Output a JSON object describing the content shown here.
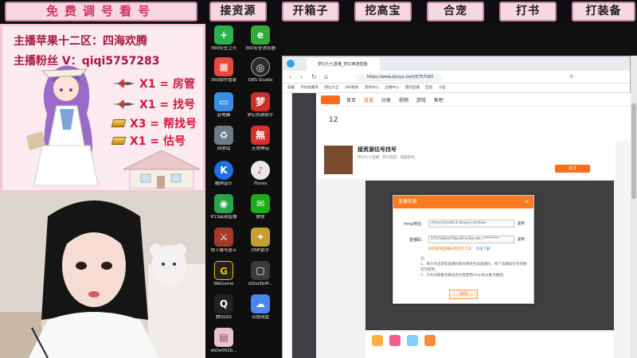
{
  "banner": {
    "main": "免费调号看号",
    "buttons": [
      "接资源",
      "开箱子",
      "挖高宝",
      "合宠",
      "打书",
      "打装备"
    ]
  },
  "info": {
    "line1": "主播苹果十二区：四海欢腾",
    "line2": "主播粉丝 V：qiqi5757283",
    "prizes": [
      {
        "icon": "plane-icon",
        "text": "X1 = 房管"
      },
      {
        "icon": "plane-icon",
        "text": "X1 = 找号"
      },
      {
        "icon": "gold-bar-icon",
        "text": "X3 = 帮找号"
      },
      {
        "icon": "gold-bar-icon",
        "text": "X1 = 估号"
      }
    ]
  },
  "desktop": {
    "icons": [
      {
        "name": "360-security-icon",
        "label": "360安全卫士",
        "color": "#2bb24c",
        "glyph": "+"
      },
      {
        "name": "360-cleaner-icon",
        "label": "360安全浏览器",
        "color": "#36a83a",
        "glyph": "e"
      },
      {
        "name": "360-software-icon",
        "label": "360软件管家",
        "color": "#e84a3a",
        "glyph": "▦"
      },
      {
        "name": "obs-studio-icon",
        "label": "OBS Studio",
        "color": "#2b2b2b",
        "glyph": "◎"
      },
      {
        "name": "computer-icon",
        "label": "此电脑",
        "color": "#3a8ee6",
        "glyph": "▭"
      },
      {
        "name": "game-assistant-icon",
        "label": "梦幻西游助手",
        "color": "#c9302c",
        "glyph": "梦"
      },
      {
        "name": "recycle-bin-icon",
        "label": "回收站",
        "color": "#6b7d8c",
        "glyph": "♻"
      },
      {
        "name": "wuxiancao-icon",
        "label": "无限神话",
        "color": "#d92f2f",
        "glyph": "無"
      },
      {
        "name": "kugou-icon",
        "label": "酷狗音乐",
        "color": "#1e6fe0",
        "glyph": "K"
      },
      {
        "name": "itunes-icon",
        "label": "iTunes",
        "color": "#e8e8e8",
        "glyph": "♪"
      },
      {
        "name": "k13-icon",
        "label": "K13高清直播",
        "color": "#2aa54a",
        "glyph": "◉"
      },
      {
        "name": "wechat-icon",
        "label": "微信",
        "color": "#1aad19",
        "glyph": "✉"
      },
      {
        "name": "mhxy-icon",
        "label": "地下城与勇士",
        "color": "#a33a2a",
        "glyph": "⚔"
      },
      {
        "name": "dnf-icon",
        "label": "DNF助手",
        "color": "#c4a032",
        "glyph": "✦"
      },
      {
        "name": "welgame-icon",
        "label": "WeGame",
        "color": "#222",
        "glyph": "G"
      },
      {
        "name": "file-icon",
        "label": "d2ba3b4f...",
        "color": "#3b3b3b",
        "glyph": "▢"
      },
      {
        "name": "qq-icon",
        "label": "腾讯QQ",
        "color": "#222",
        "glyph": "🐧"
      },
      {
        "name": "baidu-netdisk-icon",
        "label": "百度网盘",
        "color": "#4a89f3",
        "glyph": "☁"
      },
      {
        "name": "image-file-icon",
        "label": "eb0e562b...",
        "color": "#e9c2cf",
        "glyph": "▤"
      }
    ]
  },
  "browser": {
    "tab_title": "梦幻七七直播_梦幻西游直播",
    "url": "https://www.douyu.com/5757283",
    "bookmarks": [
      "收藏",
      "手机收藏夹",
      "网址大全",
      "360搜索",
      "游戏中心",
      "主播中心",
      "我的直播",
      "百度",
      "斗鱼"
    ],
    "nav": [
      "首页",
      "直播",
      "分类",
      "视频",
      "游戏",
      "鱼吧"
    ],
    "room_title": "接资源估号找号",
    "room_sub": "梦幻七七直播 · 梦幻西游 · 电脑游戏",
    "room_btn": "关注",
    "fans_count": "12"
  },
  "dialog": {
    "title": "直播信息",
    "close": "×",
    "rtmp_label": "rtmp地址：",
    "rtmp_value": "rtmp://sendtc3.douyu.com/live",
    "code_label": "直播码：",
    "code_value": "5757283rsF5Scs8?vsSecret=*********",
    "copy": "复制",
    "hint1": "如何复制直播码到官方工具",
    "hint2": "点击了解",
    "note_title": "注：",
    "note1": "1、每次点击获取直播码都会重新生成直播码，每个直播码在有效期内可使用。",
    "note2": "2、只有切换推流模式后才能使用rtmp地址推流播放。",
    "ok": "关闭"
  }
}
